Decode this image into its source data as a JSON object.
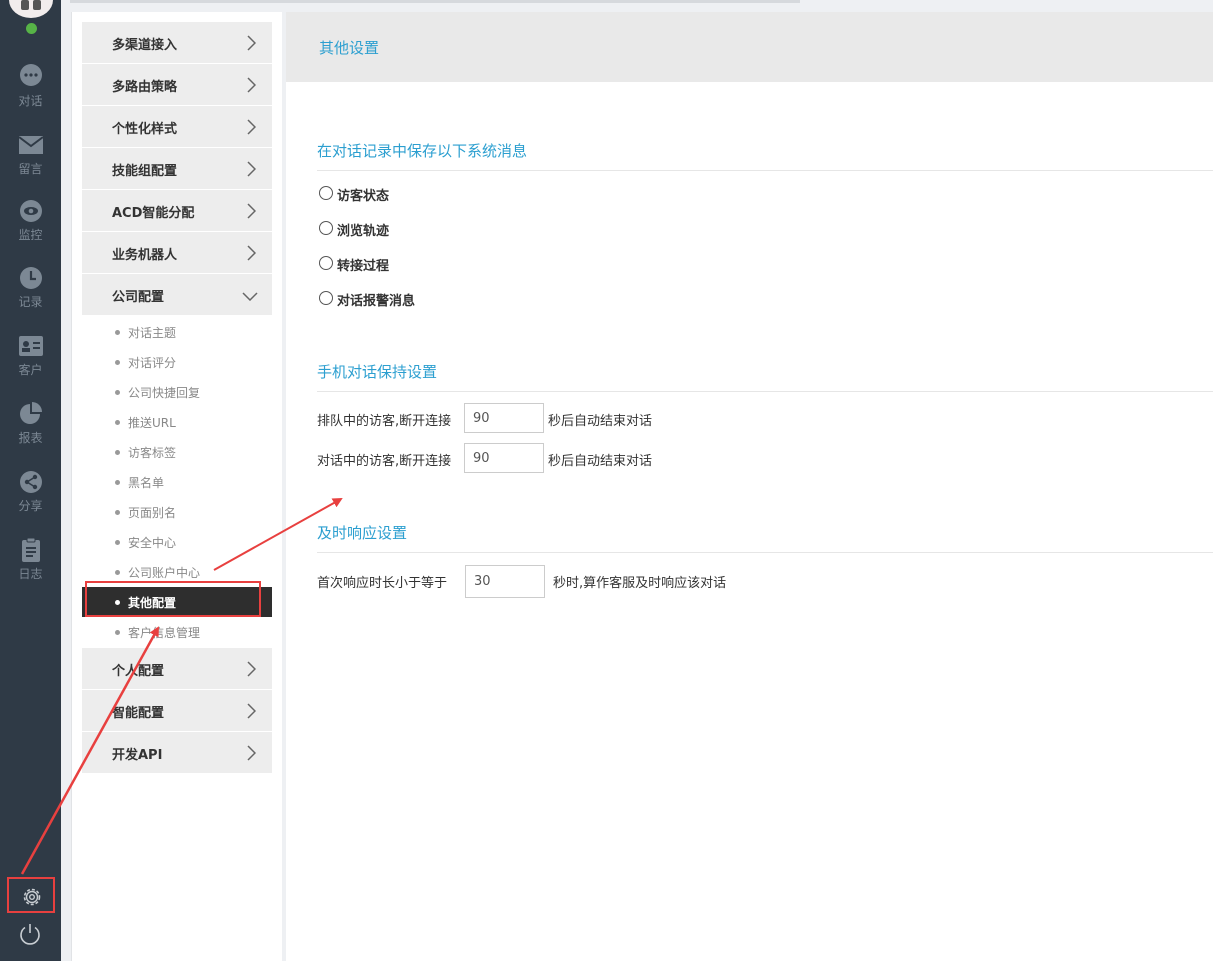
{
  "rail": {
    "items": [
      {
        "label": "对话",
        "icon": "chat-bubble-icon"
      },
      {
        "label": "留言",
        "icon": "mail-icon"
      },
      {
        "label": "监控",
        "icon": "eye-icon"
      },
      {
        "label": "记录",
        "icon": "clock-icon"
      },
      {
        "label": "客户",
        "icon": "contact-card-icon"
      },
      {
        "label": "报表",
        "icon": "pie-chart-icon"
      },
      {
        "label": "分享",
        "icon": "share-icon"
      },
      {
        "label": "日志",
        "icon": "clipboard-icon"
      }
    ],
    "settings_icon": "gear-icon",
    "power_icon": "power-icon"
  },
  "menu": {
    "groups_top": [
      {
        "label": "多渠道接入"
      },
      {
        "label": "多路由策略"
      },
      {
        "label": "个性化样式"
      },
      {
        "label": "技能组配置"
      },
      {
        "label": "ACD智能分配"
      },
      {
        "label": "业务机器人"
      }
    ],
    "expanded_group": {
      "label": "公司配置"
    },
    "sub_items": [
      {
        "label": "对话主题"
      },
      {
        "label": "对话评分"
      },
      {
        "label": "公司快捷回复"
      },
      {
        "label": "推送URL"
      },
      {
        "label": "访客标签"
      },
      {
        "label": "黑名单"
      },
      {
        "label": "页面别名"
      },
      {
        "label": "安全中心"
      },
      {
        "label": "公司账户中心"
      },
      {
        "label": "其他配置"
      },
      {
        "label": "客户信息管理"
      }
    ],
    "groups_bottom": [
      {
        "label": "个人配置"
      },
      {
        "label": "智能配置"
      },
      {
        "label": "开发API"
      }
    ]
  },
  "main": {
    "title": "其他设置",
    "section1": {
      "title": "在对话记录中保存以下系统消息",
      "options": [
        "访客状态",
        "浏览轨迹",
        "转接过程",
        "对话报警消息"
      ]
    },
    "section2": {
      "title": "手机对话保持设置",
      "rows": [
        {
          "label": "排队中的访客,断开连接",
          "value": "90",
          "suffix": "秒后自动结束对话"
        },
        {
          "label": "对话中的访客,断开连接",
          "value": "90",
          "suffix": "秒后自动结束对话"
        }
      ]
    },
    "section3": {
      "title": "及时响应设置",
      "row": {
        "label": "首次响应时长小于等于",
        "value": "30",
        "suffix": "秒时,算作客服及时响应该对话"
      }
    }
  },
  "colors": {
    "rail_bg": "#2f3a46",
    "accent_blue": "#2c9fd0",
    "annotation_red": "#e8403f",
    "active_item_bg": "#2e2e2e",
    "online_green": "#57b347"
  }
}
